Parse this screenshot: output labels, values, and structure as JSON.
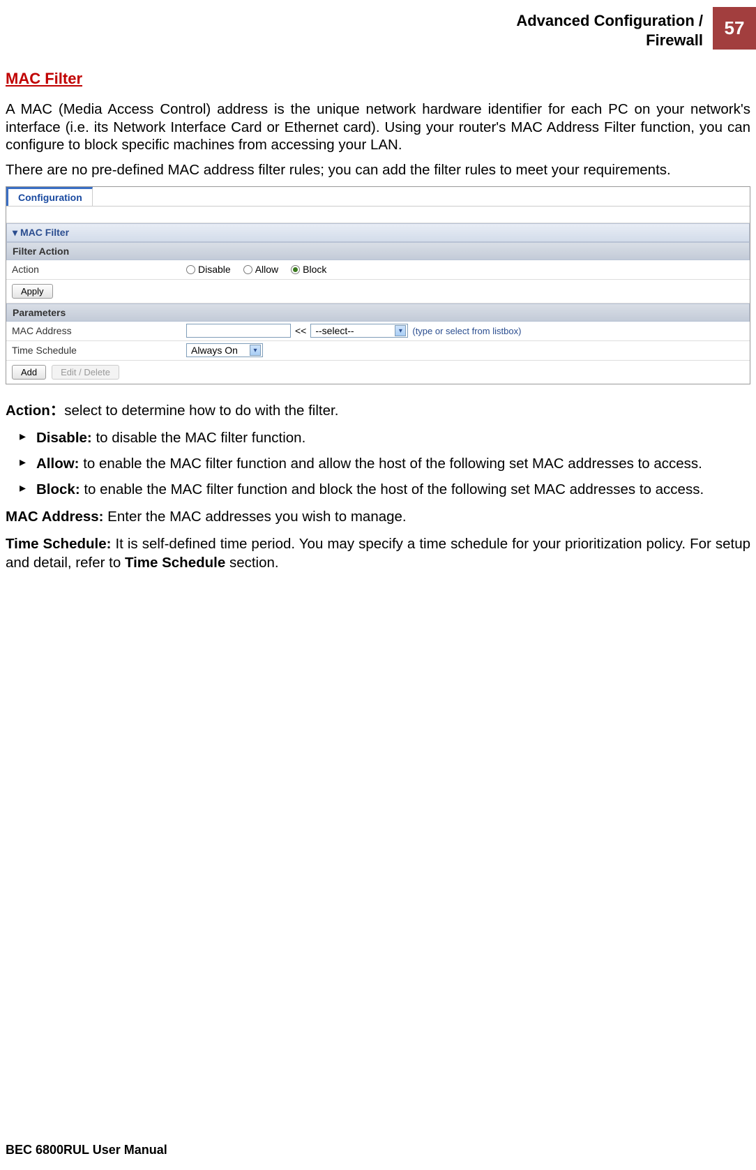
{
  "header": {
    "breadcrumb_line1": "Advanced Configuration /",
    "breadcrumb_line2": "Firewall",
    "page_number": "57"
  },
  "section_title": "MAC Filter",
  "para1": "A MAC (Media Access Control) address is the unique network hardware identifier for each PC on your network's interface (i.e. its Network Interface Card or Ethernet card). Using your router's MAC Address Filter function, you can configure to block specific machines from accessing your LAN.",
  "para2": "There are no pre-defined MAC address filter rules; you can add the filter rules to meet your requirements.",
  "screenshot": {
    "tab": "Configuration",
    "section1": "MAC Filter",
    "row_filter_action": "Filter Action",
    "row_action_label": "Action",
    "radio_disable": "Disable",
    "radio_allow": "Allow",
    "radio_block": "Block",
    "apply": "Apply",
    "section2": "Parameters",
    "row_mac_label": "MAC Address",
    "mac_arrow": "<<",
    "mac_select_value": "--select--",
    "mac_hint": "(type or select from listbox)",
    "row_time_label": "Time Schedule",
    "time_select_value": "Always On",
    "add": "Add",
    "edit_delete": "Edit / Delete"
  },
  "def_action": {
    "term": "Action：",
    "text": "select to determine how to do with the filter."
  },
  "bullets": [
    {
      "term": "Disable:",
      "text": " to disable the MAC filter function."
    },
    {
      "term": "Allow:",
      "text": " to enable the MAC filter function and allow the host of the following set MAC addresses to access."
    },
    {
      "term": "Block:",
      "text": " to enable the MAC filter function and block the host of the following set MAC addresses  to access."
    }
  ],
  "def_mac": {
    "term": "MAC Address:",
    "text": " Enter the MAC addresses you wish to manage."
  },
  "def_time": {
    "term": "Time Schedule:",
    "text_before": " It is self-defined time period. You may specify a time schedule for your prioritization policy. For setup and detail, refer to ",
    "bold_ref": "Time Schedule",
    "text_after": " section."
  },
  "footer": "BEC 6800RUL User Manual"
}
